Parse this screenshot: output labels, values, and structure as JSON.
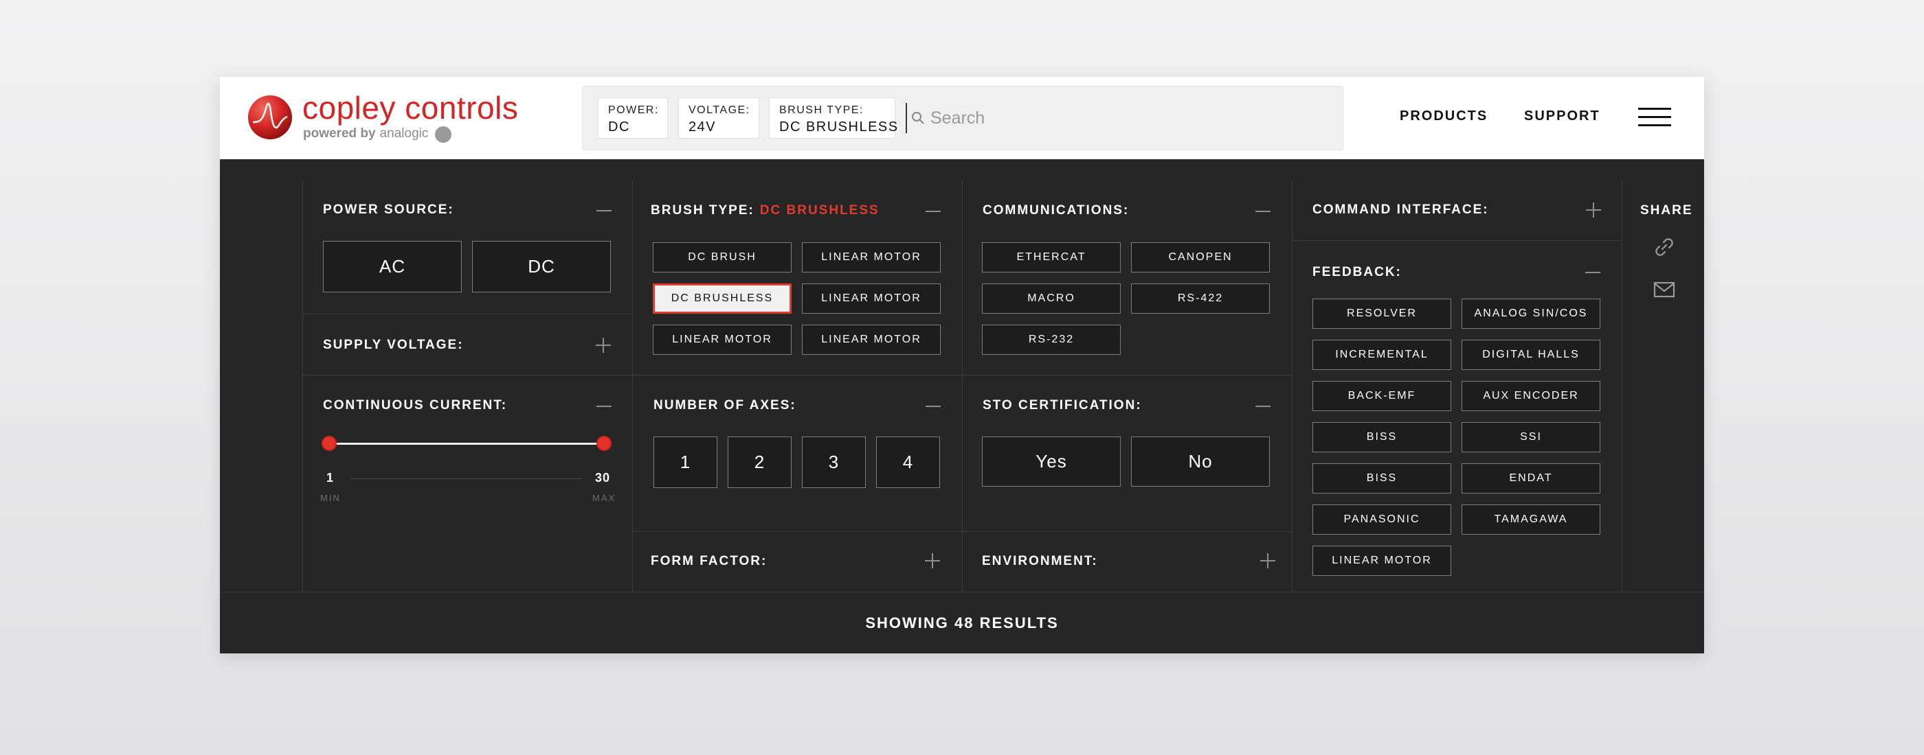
{
  "brand": {
    "name": "copley controls",
    "powered_by": "powered by",
    "powered_by_company": "analogic"
  },
  "filters": [
    {
      "key": "POWER:",
      "value": "DC"
    },
    {
      "key": "VOLTAGE:",
      "value": "24V"
    },
    {
      "key": "BRUSH TYPE:",
      "value": "DC BRUSHLESS"
    }
  ],
  "search": {
    "placeholder": "Search"
  },
  "nav": {
    "products": "PRODUCTS",
    "support": "SUPPORT"
  },
  "sections": {
    "power_source": {
      "title": "POWER SOURCE:",
      "options": [
        "AC",
        "DC"
      ]
    },
    "supply_voltage": {
      "title": "SUPPLY VOLTAGE:"
    },
    "continuous_current": {
      "title": "CONTINUOUS CURRENT:",
      "min": "1",
      "max": "30",
      "min_label": "MIN",
      "max_label": "MAX"
    },
    "brush_type": {
      "title": "BRUSH TYPE:",
      "selected": "DC BRUSHLESS",
      "options": [
        "DC BRUSH",
        "LINEAR MOTOR",
        "DC BRUSHLESS",
        "LINEAR MOTOR",
        "LINEAR MOTOR",
        "LINEAR MOTOR"
      ]
    },
    "number_of_axes": {
      "title": "NUMBER OF AXES:",
      "options": [
        "1",
        "2",
        "3",
        "4"
      ]
    },
    "form_factor": {
      "title": "FORM FACTOR:"
    },
    "communications": {
      "title": "COMMUNICATIONS:",
      "options": [
        "ETHERCAT",
        "CANOPEN",
        "MACRO",
        "RS-422",
        "RS-232"
      ]
    },
    "sto_certification": {
      "title": "STO CERTIFICATION:",
      "options": [
        "Yes",
        "No"
      ]
    },
    "environment": {
      "title": "ENVIRONMENT:"
    },
    "command_interface": {
      "title": "COMMAND INTERFACE:"
    },
    "feedback": {
      "title": "FEEDBACK:",
      "options": [
        "RESOLVER",
        "ANALOG SIN/COS",
        "INCREMENTAL",
        "DIGITAL HALLS",
        "BACK-EMF",
        "AUX ENCODER",
        "BISS",
        "SSI",
        "BISS",
        "ENDAT",
        "PANASONIC",
        "TAMAGAWA",
        "LINEAR MOTOR"
      ]
    }
  },
  "share": {
    "label": "SHARE"
  },
  "results": {
    "text": "SHOWING 48 RESULTS"
  },
  "colors": {
    "accent": "#e23a2e",
    "brand_red": "#d42424",
    "panel_bg": "#262626"
  }
}
